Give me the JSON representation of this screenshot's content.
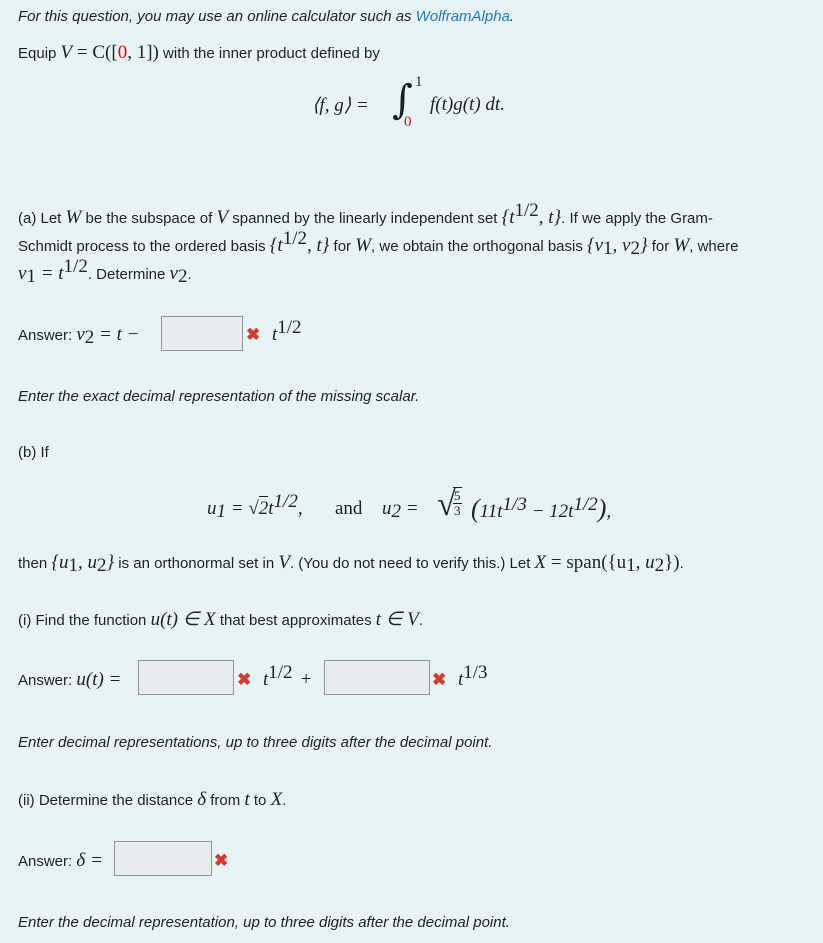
{
  "intro": {
    "calc_text": "For this question, you may use an online calculator such as ",
    "calc_link": "WolframAlpha",
    "calc_end": ".",
    "equip_prefix": "Equip ",
    "equip_math_V": "V",
    "equip_math_eq": " = C([",
    "equip_math_zero": "0",
    "equip_math_rest": ", 1])",
    "equip_suffix": " with the inner product defined by",
    "inner_product_lhs": "⟨f, g⟩ = ",
    "integral_sign": "∫",
    "integral_upper": "1",
    "integral_lower": "0",
    "integrand": "f(t)g(t) dt."
  },
  "part_a": {
    "line1_a": "(a) Let ",
    "line1_W": "W",
    "line1_b": " be the subspace of ",
    "line1_V": "V",
    "line1_c": " spanned by the linearly independent set ",
    "line1_set": "{t",
    "line1_set_exp": "1/2",
    "line1_set_end": ", t}",
    "line1_d": ". If we apply the Gram-",
    "line2_a": "Schmidt process to the ordered basis ",
    "line2_set": "{t",
    "line2_set_exp": "1/2",
    "line2_set_end": ", t}",
    "line2_b": " for ",
    "line2_W": "W",
    "line2_c": ", we obtain the orthogonal basis ",
    "line2_basis": "{v",
    "line2_basis_sub1": "1",
    "line2_basis_mid": ", v",
    "line2_basis_sub2": "2",
    "line2_basis_end": "}",
    "line2_d": " for ",
    "line2_W2": "W",
    "line2_e": ", where",
    "line3_v": "v",
    "line3_sub": "1",
    "line3_eq": " = t",
    "line3_exp": "1/2",
    "line3_a": ". Determine ",
    "line3_v2": "v",
    "line3_v2_sub": "2",
    "line3_end": ".",
    "answer_label": "Answer: ",
    "answer_math_v": "v",
    "answer_math_sub": "2",
    "answer_math_rest": " = t  −",
    "answer_value": "",
    "answer_suffix_t": "t",
    "answer_suffix_exp": "1/2",
    "hint": "Enter the exact decimal representation of the missing scalar."
  },
  "part_b": {
    "intro": "(b) If",
    "u1_lhs": "u",
    "u1_sub": "1",
    "u1_eq": " = ",
    "u1_sqrt": "2",
    "u1_t": "t",
    "u1_exp": "1/2",
    "u1_comma": ",",
    "and_text": "and",
    "u2_lhs": "u",
    "u2_sub": "2",
    "u2_eq": " = ",
    "u2_frac_num": "5",
    "u2_frac_den": "3",
    "u2_paren_open": "(",
    "u2_term1": "11t",
    "u2_term1_exp": "1/3",
    "u2_minus": " − ",
    "u2_term2": "12t",
    "u2_term2_exp": "1/2",
    "u2_paren_close": ")",
    "u2_comma": ",",
    "then_a": "then ",
    "then_set": "{u",
    "then_sub1": "1",
    "then_mid": ", u",
    "then_sub2": "2",
    "then_end": "}",
    "then_b": " is an orthonormal set in ",
    "then_V": "V",
    "then_c": ". (You do not need to verify this.) Let ",
    "then_X": "X",
    "then_eq": " = span({u",
    "then_sub3": "1",
    "then_mid2": ", u",
    "then_sub4": "2",
    "then_close": "})",
    "then_end2": ".",
    "part_i": {
      "q_a": "(i) Find the function ",
      "q_u": "u(t) ∈ X",
      "q_b": " that best approximates ",
      "q_t": "t ∈ V",
      "q_end": ".",
      "answer_label": "Answer: ",
      "answer_math": "u(t) =",
      "answer_value_1": "",
      "term1_t": "t",
      "term1_exp": "1/2",
      "plus": "+",
      "answer_value_2": "",
      "term2_t": "t",
      "term2_exp": "1/3",
      "hint": "Enter decimal representations, up to three digits after the decimal point."
    },
    "part_ii": {
      "q_a": "(ii) Determine the distance ",
      "q_delta": "δ",
      "q_b": " from ",
      "q_t": "t",
      "q_c": " to ",
      "q_X": "X",
      "q_end": ".",
      "answer_label": "Answer: ",
      "answer_math": "δ =",
      "answer_value": "",
      "hint": "Enter the decimal representation, up to three digits after the decimal point."
    }
  },
  "feedback": {
    "incorrect_icon": "✖"
  }
}
